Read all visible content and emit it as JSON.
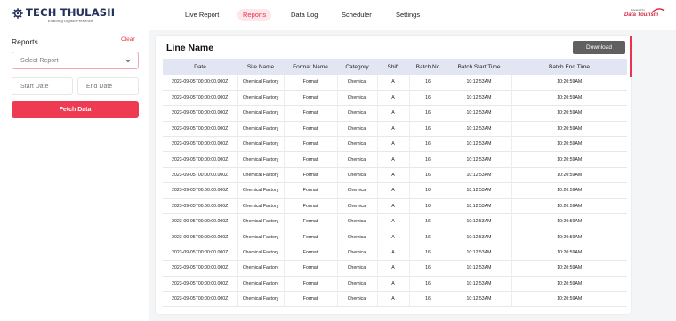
{
  "header": {
    "logo": {
      "name": "TECH THULASII",
      "tagline": "Enabling Digital Presence"
    },
    "nav": [
      {
        "label": "Live Report",
        "active": false
      },
      {
        "label": "Reports",
        "active": true
      },
      {
        "label": "Data Log",
        "active": false
      },
      {
        "label": "Scheduler",
        "active": false
      },
      {
        "label": "Settings",
        "active": false
      }
    ],
    "brand": {
      "powered_by": "Powered by",
      "name": "Data Tourism"
    }
  },
  "sidebar": {
    "title": "Reports",
    "clear_label": "Clear",
    "select_placeholder": "Select Report",
    "start_date_placeholder": "Start Date",
    "end_date_placeholder": "End Date",
    "fetch_label": "Fetch Data"
  },
  "main": {
    "title": "Line Name",
    "download_label": "Download",
    "columns": [
      "Date",
      "Site Name",
      "Format Name",
      "Category",
      "Shift",
      "Batch No",
      "Batch Start Time",
      "Batch End Time"
    ],
    "rows": [
      [
        "2023-09-05T00:00:00.000Z",
        "Chemical Factory",
        "Format",
        "Chemical",
        "A",
        "16",
        "10:12:53AM",
        "10:20:59AM"
      ],
      [
        "2023-09-05T00:00:00.000Z",
        "Chemical Factory",
        "Format",
        "Chemical",
        "A",
        "16",
        "10:12:53AM",
        "10:20:59AM"
      ],
      [
        "2023-09-05T00:00:00.000Z",
        "Chemical Factory",
        "Format",
        "Chemical",
        "A",
        "16",
        "10:12:53AM",
        "10:20:59AM"
      ],
      [
        "2023-09-05T00:00:00.000Z",
        "Chemical Factory",
        "Format",
        "Chemical",
        "A",
        "16",
        "10:12:53AM",
        "10:20:59AM"
      ],
      [
        "2023-09-05T00:00:00.000Z",
        "Chemical Factory",
        "Format",
        "Chemical",
        "A",
        "16",
        "10:12:53AM",
        "10:20:59AM"
      ],
      [
        "2023-09-05T00:00:00.000Z",
        "Chemical Factory",
        "Format",
        "Chemical",
        "A",
        "16",
        "10:12:53AM",
        "10:20:59AM"
      ],
      [
        "2023-09-05T00:00:00.000Z",
        "Chemical Factory",
        "Format",
        "Chemical",
        "A",
        "16",
        "10:12:53AM",
        "10:20:59AM"
      ],
      [
        "2023-09-05T00:00:00.000Z",
        "Chemical Factory",
        "Format",
        "Chemical",
        "A",
        "16",
        "10:12:53AM",
        "10:20:59AM"
      ],
      [
        "2023-09-05T00:00:00.000Z",
        "Chemical Factory",
        "Format",
        "Chemical",
        "A",
        "16",
        "10:12:53AM",
        "10:20:59AM"
      ],
      [
        "2023-09-05T00:00:00.000Z",
        "Chemical Factory",
        "Format",
        "Chemical",
        "A",
        "16",
        "10:12:53AM",
        "10:20:59AM"
      ],
      [
        "2023-09-05T00:00:00.000Z",
        "Chemical Factory",
        "Format",
        "Chemical",
        "A",
        "16",
        "10:12:53AM",
        "10:20:59AM"
      ],
      [
        "2023-09-05T00:00:00.000Z",
        "Chemical Factory",
        "Format",
        "Chemical",
        "A",
        "16",
        "10:12:53AM",
        "10:20:59AM"
      ],
      [
        "2023-09-05T00:00:00.000Z",
        "Chemical Factory",
        "Format",
        "Chemical",
        "A",
        "16",
        "10:12:53AM",
        "10:20:59AM"
      ],
      [
        "2023-09-05T00:00:00.000Z",
        "Chemical Factory",
        "Format",
        "Chemical",
        "A",
        "16",
        "10:12:53AM",
        "10:20:59AM"
      ],
      [
        "2023-09-05T00:00:00.000Z",
        "Chemical Factory",
        "Format",
        "Chemical",
        "A",
        "16",
        "10:12:53AM",
        "10:20:59AM"
      ]
    ]
  },
  "colors": {
    "accent": "#ee3a52",
    "logo_navy": "#22305a",
    "table_header": "#e2e6f3",
    "download_bg": "#606060"
  }
}
